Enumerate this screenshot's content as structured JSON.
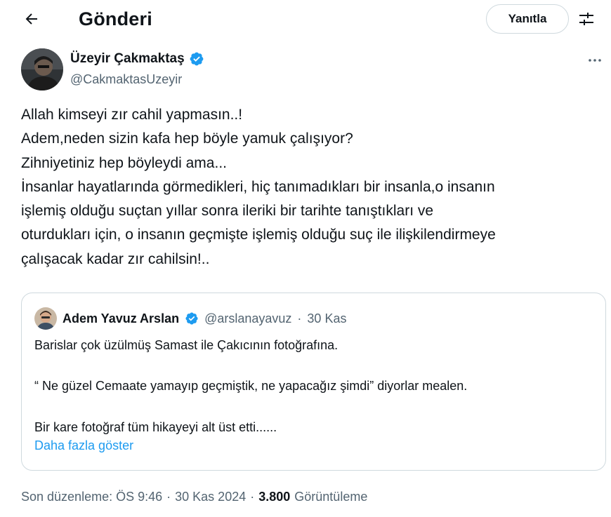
{
  "header": {
    "title": "Gönderi",
    "reply_label": "Yanıtla",
    "back_icon": "arrow-left-icon",
    "settings_icon": "sliders-icon"
  },
  "author": {
    "name": "Üzeyir Çakmaktaş",
    "handle": "@CakmaktasUzeyir",
    "verified": true
  },
  "post": {
    "lines": [
      "Allah kimseyi zır cahil yapmasın..!",
      "Adem,neden sizin kafa hep böyle yamuk çalışıyor?",
      "Zihniyetiniz hep böyleydi ama...",
      "İnsanlar hayatlarında görmedikleri, hiç tanımadıkları bir insanla,o insanın",
      "işlemiş olduğu suçtan yıllar sonra ileriki bir tarihte tanıştıkları ve",
      "oturdukları için, o insanın geçmişte işlemiş olduğu suç ile ilişkilendirmeye",
      "çalışacak kadar zır cahilsin!.."
    ]
  },
  "quote": {
    "name": "Adem Yavuz Arslan",
    "handle": "@arslanayavuz",
    "separator": "·",
    "date": "30 Kas",
    "verified": true,
    "lines": [
      "Barislar çok üzülmüş Samast ile Çakıcının fotoğrafına.",
      "“ Ne güzel Cemaate yamayıp geçmiştik, ne yapacağız şimdi” diyorlar mealen.",
      "Bir kare fotoğraf tüm hikayeyi alt üst etti......"
    ],
    "show_more": "Daha fazla göster"
  },
  "meta": {
    "edited_label": "Son düzenleme: ÖS 9:46",
    "separator": "·",
    "date": "30 Kas 2024",
    "views_count": "3.800",
    "views_label": "Görüntüleme"
  },
  "colors": {
    "accent": "#1d9bf0",
    "secondary_text": "#536471",
    "border": "#cfd9de"
  }
}
